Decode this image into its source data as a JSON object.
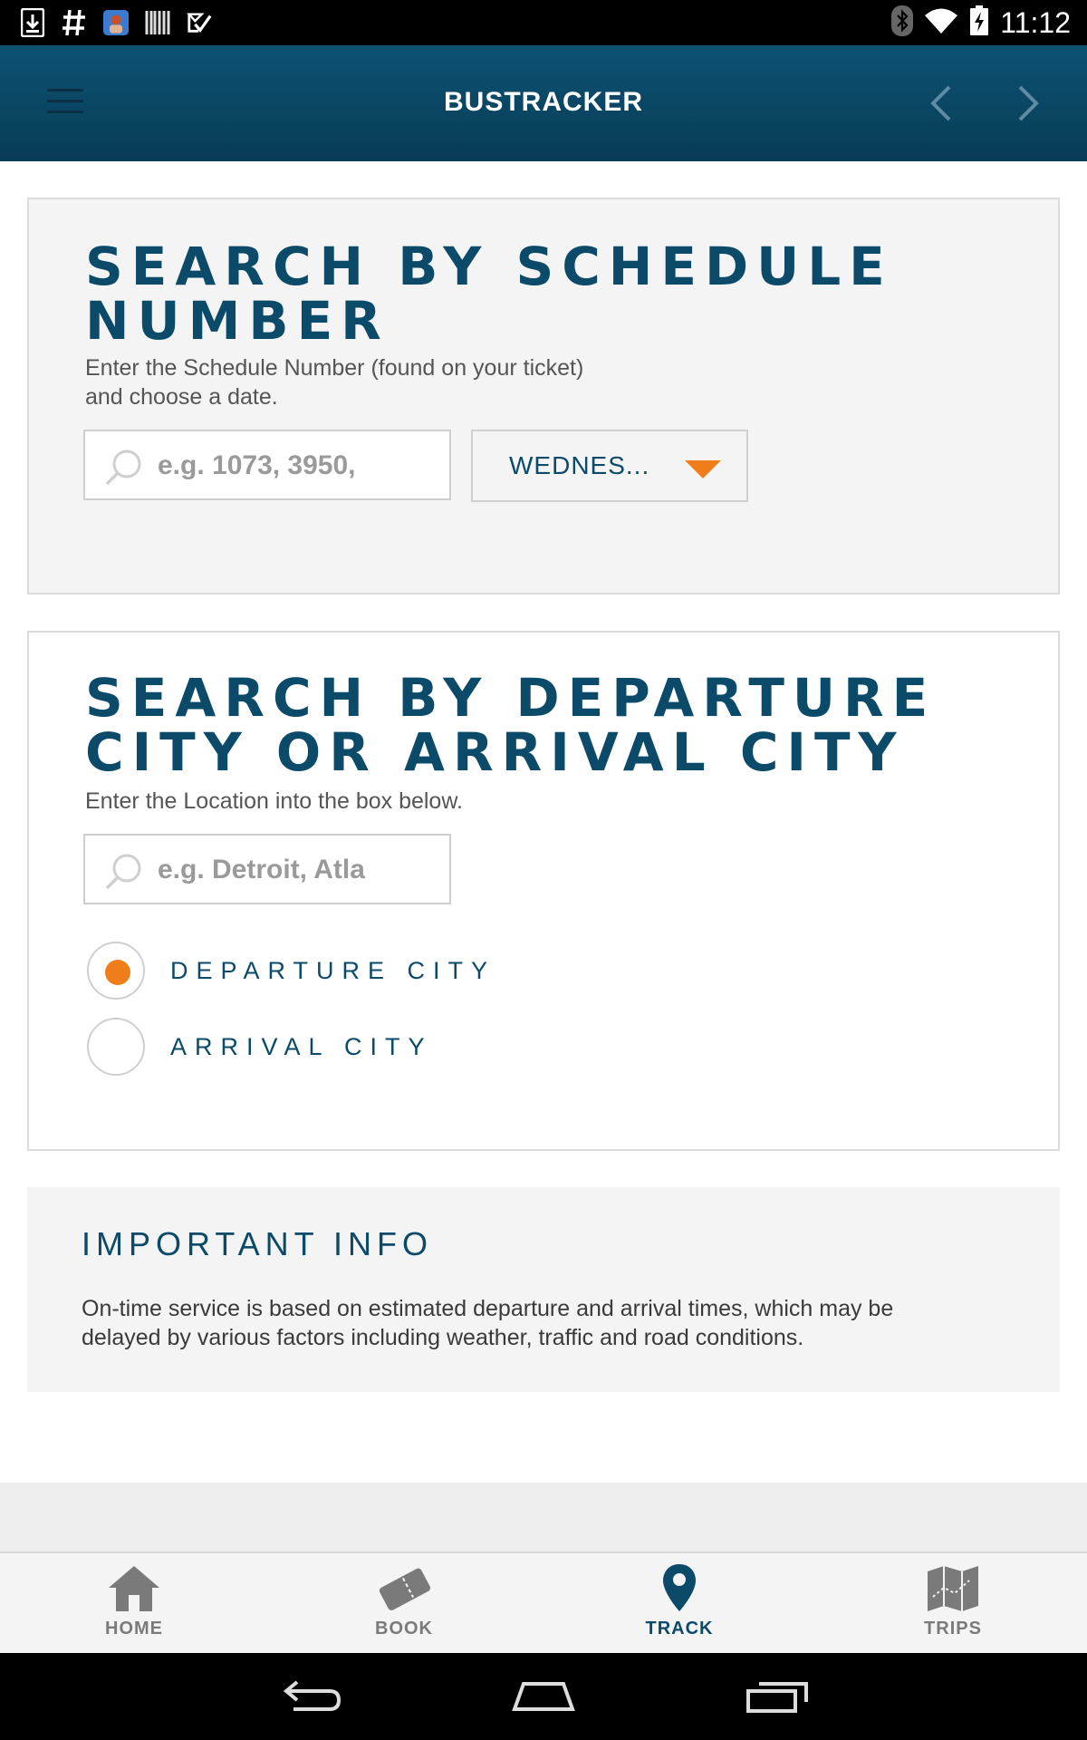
{
  "status_bar": {
    "time": "11:12",
    "left_icons": [
      "download-icon",
      "hashtag-icon",
      "app-avatar-icon",
      "barcode-icon",
      "check-mail-icon"
    ],
    "right_icons": [
      "bluetooth-icon",
      "wifi-icon",
      "battery-charging-icon"
    ]
  },
  "app_bar": {
    "title": "BUSTRACKER",
    "icons": [
      "menu-icon",
      "chevron-left-icon",
      "chevron-right-icon"
    ]
  },
  "schedule_search": {
    "title_line1": "SEARCH BY SCHEDULE",
    "title_line2": "NUMBER",
    "description_line1": "Enter the Schedule Number (found on your ticket)",
    "description_line2": "and choose a date.",
    "input_value": "",
    "input_placeholder": "e.g. 1073, 3950,",
    "date_selected": "WEDNES..."
  },
  "city_search": {
    "title_line1": "SEARCH BY DEPARTURE",
    "title_line2": "CITY OR ARRIVAL CITY",
    "description": "Enter the Location into the box below.",
    "input_value": "",
    "input_placeholder": "e.g. Detroit, Atla",
    "radio_options": [
      {
        "label": "DEPARTURE CITY",
        "checked": true
      },
      {
        "label": "ARRIVAL CITY",
        "checked": false
      }
    ]
  },
  "info": {
    "title": "IMPORTANT INFO",
    "text_line1": "On-time service is based on estimated departure and arrival times, which may be",
    "text_line2": "delayed by various factors including weather, traffic and road conditions."
  },
  "bottom_nav": {
    "items": [
      {
        "label": "HOME",
        "icon": "home-icon",
        "active": false
      },
      {
        "label": "BOOK",
        "icon": "ticket-icon",
        "active": false
      },
      {
        "label": "TRACK",
        "icon": "map-pin-icon",
        "active": true
      },
      {
        "label": "TRIPS",
        "icon": "map-icon",
        "active": false
      }
    ]
  },
  "colors": {
    "brand_dark": "#0b4a68",
    "accent": "#ef7d1a",
    "app_bar": "#0a4663"
  }
}
